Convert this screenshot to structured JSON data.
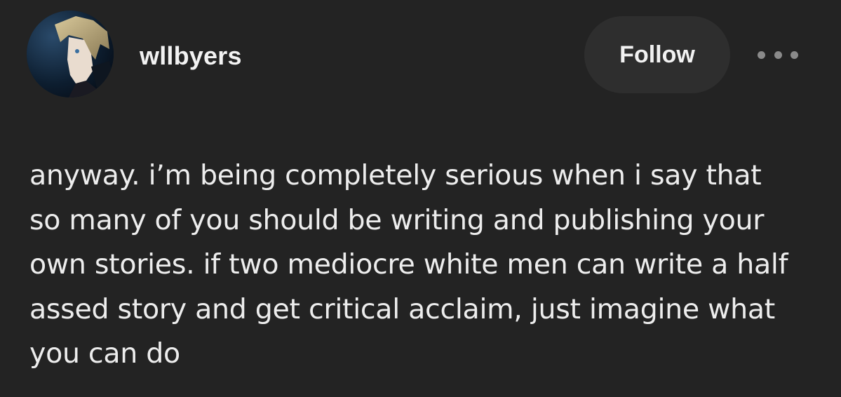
{
  "post": {
    "username": "wllbyers",
    "follow_label": "Follow",
    "more_icon": "more-horizontal-icon",
    "avatar_icon": "avatar-anime-character",
    "body_lines": [
      "anyway. i’m being completely serious when i say that",
      "so many of you should be writing and publishing your",
      "own stories. if two mediocre white men can write a half",
      "assed story and get critical acclaim, just imagine what",
      "you can do"
    ]
  },
  "colors": {
    "background": "#232323",
    "button_bg": "#2e2e2e",
    "text": "#ededed",
    "muted": "#8a8a8a"
  }
}
